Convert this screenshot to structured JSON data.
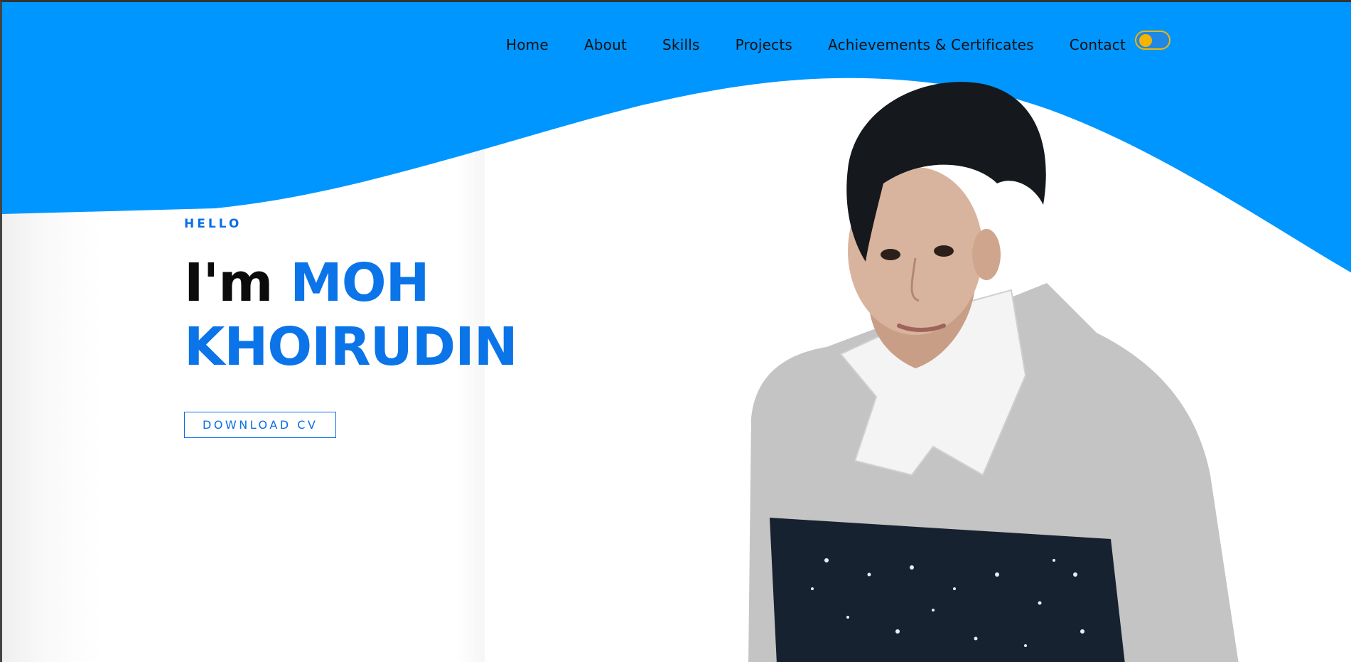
{
  "theme": {
    "accent": "#0096ff",
    "text_accent": "#0a74e8",
    "toggle": "#f4b400"
  },
  "nav": {
    "items": [
      {
        "label": "Home"
      },
      {
        "label": "About"
      },
      {
        "label": "Skills"
      },
      {
        "label": "Projects"
      },
      {
        "label": "Achievements & Certificates"
      },
      {
        "label": "Contact"
      }
    ],
    "theme_toggle_icon": "toggle-switch"
  },
  "hero": {
    "greeting": "HELLO",
    "intro": "I'm",
    "name_first": "MOH",
    "name_last": "KHOIRUDIN",
    "download_button": "DOWNLOAD CV"
  },
  "portrait": {
    "icon": "profile-photo"
  }
}
